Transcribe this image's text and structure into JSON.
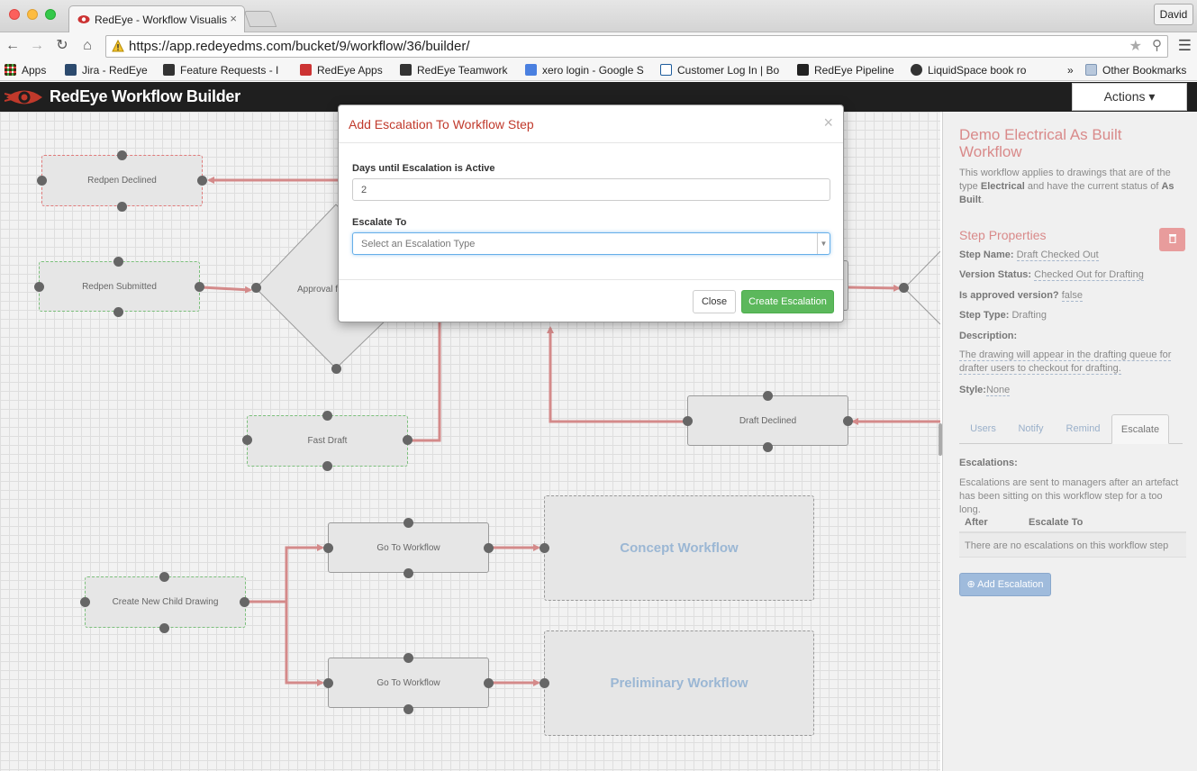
{
  "browser": {
    "tab_title": "RedEye - Workflow Visualis",
    "tab_close": "×",
    "profile": "David",
    "url": "https://app.redeyedms.com/bucket/9/workflow/36/builder/",
    "bookmarks": [
      {
        "label": "Apps",
        "icon": "apps-grid-icon",
        "color": "#d44"
      },
      {
        "label": "Jira - RedEye",
        "icon": "jira-icon",
        "color": "#2c4a6e"
      },
      {
        "label": "Feature Requests - I",
        "icon": "teamwork-icon",
        "color": "#333"
      },
      {
        "label": "RedEye Apps",
        "icon": "redeye-icon",
        "color": "#c33"
      },
      {
        "label": "RedEye Teamwork",
        "icon": "teamwork-icon",
        "color": "#333"
      },
      {
        "label": "xero login - Google S",
        "icon": "google-icon",
        "color": "#4a80e0"
      },
      {
        "label": "Customer Log In | Bo",
        "icon": "b-icon",
        "color": "#1d5c9c"
      },
      {
        "label": "RedEye Pipeline",
        "icon": "pipeline-icon",
        "color": "#222"
      },
      {
        "label": "LiquidSpace book ro",
        "icon": "liquidspace-icon",
        "color": "#333"
      }
    ],
    "bookmarks_more": "»",
    "other_bookmarks": "Other Bookmarks"
  },
  "app": {
    "title": "RedEye Workflow Builder",
    "actions": "Actions ▾"
  },
  "canvas": {
    "nodes": {
      "redpen_declined": "Redpen Declined",
      "redpen_submitted": "Redpen Submitted",
      "approval": "Approval fo",
      "fast_draft": "Fast Draft",
      "draft_declined": "Draft Declined",
      "go_to_workflow_1": "Go To Workflow",
      "go_to_workflow_2": "Go To Workflow",
      "create_child": "Create New Child Drawing",
      "concept_workflow": "Concept Workflow",
      "preliminary_workflow": "Preliminary Workflow"
    }
  },
  "panel": {
    "workflow_title": "Demo Electrical As Built Workflow",
    "workflow_desc_1": "This workflow applies to drawings that are of the type ",
    "workflow_desc_type": "Electrical",
    "workflow_desc_2": " and have the current status of ",
    "workflow_desc_status": "As Built",
    "workflow_desc_3": ".",
    "props_title": "Step Properties",
    "step_name_label": "Step Name:",
    "step_name": "Draft Checked Out",
    "version_status_label": "Version Status:",
    "version_status": "Checked Out for Drafting",
    "approved_label": "Is approved version?",
    "approved": "false",
    "step_type_label": "Step Type:",
    "step_type": "Drafting",
    "description_label": "Description:",
    "description": "The drawing will appear in the drafting queue for drafter users to checkout for drafting.",
    "style_label": "Style:",
    "style": "None",
    "tabs": [
      "Users",
      "Notify",
      "Remind",
      "Escalate"
    ],
    "escalations_heading": "Escalations:",
    "escalations_desc": "Escalations are sent to managers after an artefact has been sitting on this workflow step for a too long.",
    "col_after": "After",
    "col_escalate_to": "Escalate To",
    "empty_row": "There are no escalations on this workflow step",
    "add_escalation": "⊕ Add Escalation"
  },
  "modal": {
    "title": "Add Escalation To Workflow Step",
    "close_x": "×",
    "days_label": "Days until Escalation is Active",
    "days_value": "2",
    "escalate_to_label": "Escalate To",
    "escalate_placeholder": "Select an Escalation Type",
    "close_button": "Close",
    "create_button": "Create Escalation"
  },
  "colors": {
    "accent": "#c0392b",
    "connector": "#d48a8a",
    "success": "#5cb85c",
    "link": "#9fbbdc"
  }
}
